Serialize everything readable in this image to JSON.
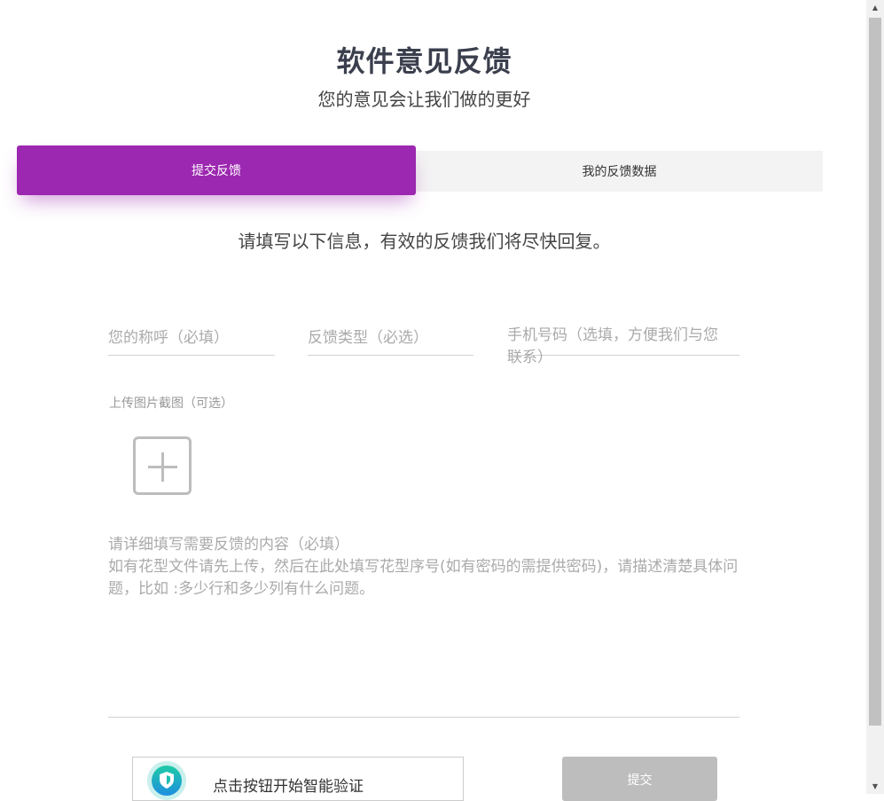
{
  "header": {
    "title": "软件意见反馈",
    "subtitle": "您的意见会让我们做的更好"
  },
  "tabs": [
    {
      "label": "提交反馈",
      "active": true
    },
    {
      "label": "我的反馈数据",
      "active": false
    }
  ],
  "form": {
    "hint": "请填写以下信息，有效的反馈我们将尽快回复。",
    "name_placeholder": "您的称呼（必填）",
    "type_placeholder": "反馈类型（必选）",
    "phone_placeholder": "手机号码（选填，方便我们与您联系）",
    "upload_label": "上传图片截图（可选）",
    "content_placeholder_line1": "请详细填写需要反馈的内容（必填）",
    "content_placeholder_line2": "如有花型文件请先上传，然后在此处填写花型序号(如有密码的需提供密码)，请描述清楚具体问题，比如 :多少行和多少列有什么问题。",
    "verify_text": "点击按钮开始智能验证",
    "submit_label": "提交"
  },
  "colors": {
    "accent": "#9c27b0",
    "submit_disabled": "#bdbdbd"
  }
}
